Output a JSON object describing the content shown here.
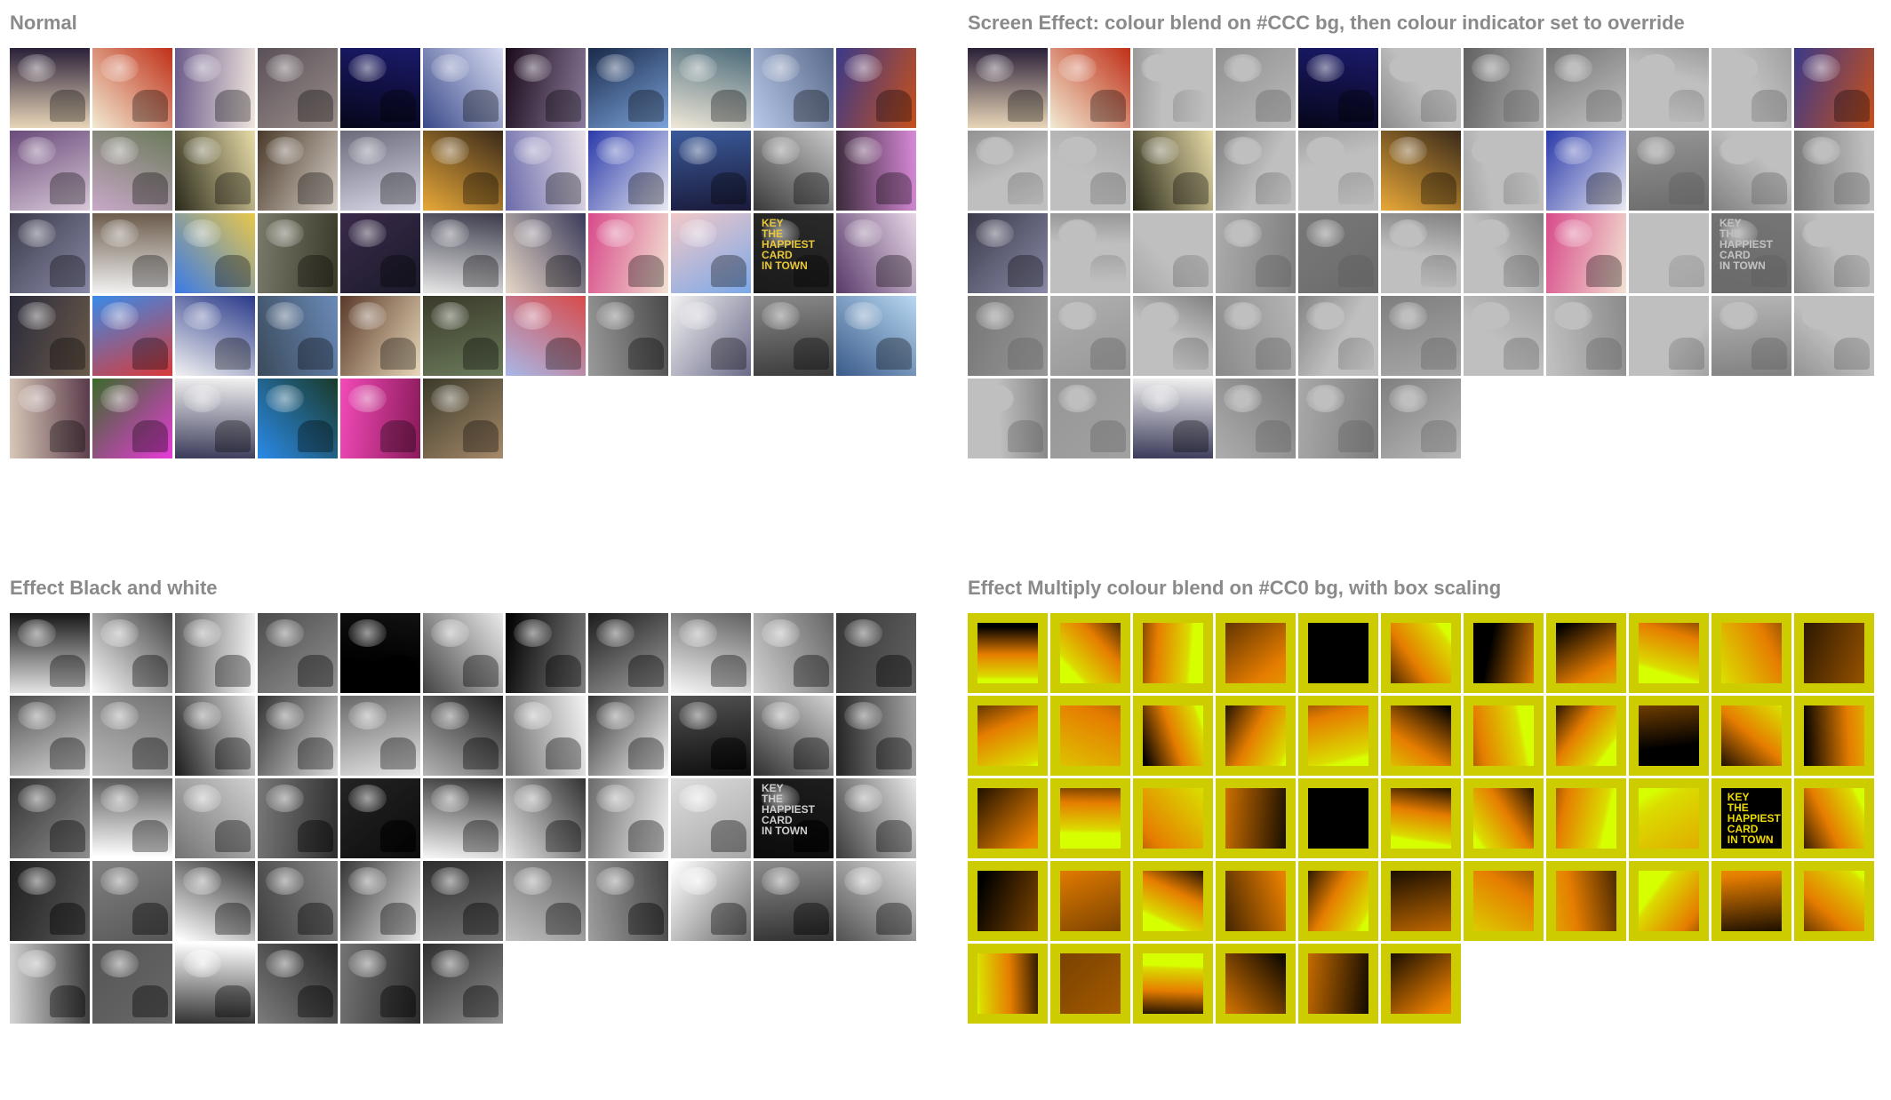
{
  "panels": [
    {
      "title": "Normal",
      "effect": "normal",
      "faded_indices": []
    },
    {
      "title": "Screen Effect: colour blend on #CCC bg, then colour indicator set to override",
      "effect": "screen",
      "blend_bg": "#CCCCCC",
      "faded_indices": [
        2,
        3,
        5,
        6,
        7,
        8,
        9,
        11,
        12,
        14,
        15,
        17,
        19,
        20,
        21,
        23,
        24,
        25,
        26,
        27,
        28,
        30,
        31,
        32,
        33,
        34,
        35,
        36,
        37,
        38,
        39,
        40,
        41,
        42,
        43,
        44,
        45,
        47,
        48,
        49,
        51,
        52,
        53
      ]
    },
    {
      "title": "Effect Black and white",
      "effect": "bw",
      "faded_indices": []
    },
    {
      "title": "Effect Multiply colour blend on #CC0 bg, with box scaling",
      "effect": "multiply",
      "blend_bg": "#CCCC00",
      "faded_indices": []
    }
  ],
  "thumbnails": [
    {
      "name": "bridge-thumb",
      "colors": [
        "#e8d5b8",
        "#2a2038"
      ]
    },
    {
      "name": "drink-thumb",
      "colors": [
        "#f2ead2",
        "#c03018"
      ]
    },
    {
      "name": "dog-plate-thumb",
      "colors": [
        "#6a5a8a",
        "#f0e6de"
      ]
    },
    {
      "name": "steps-dog-thumb",
      "colors": [
        "#5a5058",
        "#9a8e8a"
      ]
    },
    {
      "name": "night-harbour-thumb",
      "colors": [
        "#1a1a6a",
        "#06061a"
      ]
    },
    {
      "name": "dog-closeup-thumb",
      "colors": [
        "#d8dcf2",
        "#3a4a8a"
      ]
    },
    {
      "name": "stormy-sky-thumb",
      "colors": [
        "#8a7a9a",
        "#1a0a1a"
      ]
    },
    {
      "name": "ship-thumb",
      "colors": [
        "#7aa2da",
        "#1a2a4a"
      ]
    },
    {
      "name": "dog-waterfront-thumb",
      "colors": [
        "#f0e8d8",
        "#4a6a7a"
      ]
    },
    {
      "name": "shoreline-thumb",
      "colors": [
        "#b8c8e8",
        "#5a6a8a"
      ]
    },
    {
      "name": "palace-night-thumb",
      "colors": [
        "#3a3a8a",
        "#c8501a"
      ]
    },
    {
      "name": "kitchen-thumb",
      "colors": [
        "#6a4a7a",
        "#d8c8d8"
      ]
    },
    {
      "name": "road-hill-thumb",
      "colors": [
        "#6a7a5a",
        "#c8a8c8"
      ]
    },
    {
      "name": "shadow-dog-thumb",
      "colors": [
        "#e8dca8",
        "#2a2a1a"
      ]
    },
    {
      "name": "window-room-thumb",
      "colors": [
        "#d8d0c8",
        "#4a3a2a"
      ]
    },
    {
      "name": "dog-bed-thumb",
      "colors": [
        "#d8d8e8",
        "#6a6a7a"
      ]
    },
    {
      "name": "dog-leash-thumb",
      "colors": [
        "#e8a838",
        "#3a2a1a"
      ]
    },
    {
      "name": "tower-dog-thumb",
      "colors": [
        "#6a6aaa",
        "#eae2ea"
      ]
    },
    {
      "name": "concert-night-thumb",
      "colors": [
        "#2a3aaa",
        "#eaeaf2"
      ]
    },
    {
      "name": "dome-building-thumb",
      "colors": [
        "#3a5a9a",
        "#1a1a3a"
      ]
    },
    {
      "name": "door-handle-thumb",
      "colors": [
        "#c8c8c8",
        "#3a3a3a"
      ]
    },
    {
      "name": "dog-pink-thumb",
      "colors": [
        "#d88ad8",
        "#3a2a3a"
      ]
    },
    {
      "name": "dog-door-thumb",
      "colors": [
        "#8a8aa8",
        "#3a3a4a"
      ]
    },
    {
      "name": "dog-pillow-thumb",
      "colors": [
        "#f2f2f2",
        "#6a5a4a"
      ]
    },
    {
      "name": "bicycle-sky-thumb",
      "colors": [
        "#3a7ae8",
        "#e8c84a"
      ]
    },
    {
      "name": "gravel-thumb",
      "colors": [
        "#7a7a6a",
        "#3a3a2a"
      ]
    },
    {
      "name": "river-dusk-thumb",
      "colors": [
        "#3a2a4a",
        "#1a1a2a"
      ]
    },
    {
      "name": "cup-thumb",
      "colors": [
        "#3a3a4a",
        "#e8e8e8"
      ]
    },
    {
      "name": "necklace-dog-thumb",
      "colors": [
        "#3a3a5a",
        "#e8d8c8"
      ]
    },
    {
      "name": "coffee-flower-thumb",
      "colors": [
        "#f2e2d2",
        "#d84a8a"
      ]
    },
    {
      "name": "skyline-sunset-thumb",
      "colors": [
        "#7aa8e8",
        "#f2c8c8"
      ]
    },
    {
      "name": "happiest-card-thumb",
      "colors": [
        "#1a1a1a",
        "#2a2a2a"
      ],
      "text": "KEY\nTHE\nHAPPIEST\nCARD\nIN TOWN",
      "text_color": "#e8c83a"
    },
    {
      "name": "dog-rock-thumb",
      "colors": [
        "#5a3a6a",
        "#e8d8e8"
      ]
    },
    {
      "name": "night-field-thumb",
      "colors": [
        "#2a2a3a",
        "#6a5a4a"
      ]
    },
    {
      "name": "napoleon-sign-thumb",
      "colors": [
        "#3a8ae8",
        "#d83a3a"
      ]
    },
    {
      "name": "sun-clouds-thumb",
      "colors": [
        "#2a3a8a",
        "#f2f2f2"
      ]
    },
    {
      "name": "dog-basket-thumb",
      "colors": [
        "#6a8ab8",
        "#3a4a5a"
      ]
    },
    {
      "name": "two-dogs-thumb",
      "colors": [
        "#e8d8b8",
        "#5a3a2a"
      ]
    },
    {
      "name": "bicycles-thumb",
      "colors": [
        "#6a7a5a",
        "#3a3a2a"
      ]
    },
    {
      "name": "street-thumb",
      "colors": [
        "#a8b8e8",
        "#d84a4a"
      ]
    },
    {
      "name": "wall-shadow-thumb",
      "colors": [
        "#9a9a9a",
        "#4a4a4a"
      ]
    },
    {
      "name": "dog-grin-thumb",
      "colors": [
        "#f2f2f2",
        "#6a6a8a"
      ]
    },
    {
      "name": "beach-dog-thumb",
      "colors": [
        "#8a8a8a",
        "#3a3a3a"
      ]
    },
    {
      "name": "beach-towel-thumb",
      "colors": [
        "#b8d8f2",
        "#3a5a8a"
      ]
    },
    {
      "name": "dog-hammock-thumb",
      "colors": [
        "#5a3a4a",
        "#d8c8b8"
      ]
    },
    {
      "name": "pink-flower-thumb",
      "colors": [
        "#e83ad8",
        "#3a6a2a"
      ]
    },
    {
      "name": "dog-portrait-thumb",
      "colors": [
        "#3a3a5a",
        "#f2f2f2"
      ]
    },
    {
      "name": "balcony-thumb",
      "colors": [
        "#2a8ae8",
        "#1a3a2a"
      ]
    },
    {
      "name": "peony-thumb",
      "colors": [
        "#f24ab8",
        "#8a1a5a"
      ]
    },
    {
      "name": "boardwalk-thumb",
      "colors": [
        "#3a3a2a",
        "#a88a6a"
      ]
    }
  ]
}
